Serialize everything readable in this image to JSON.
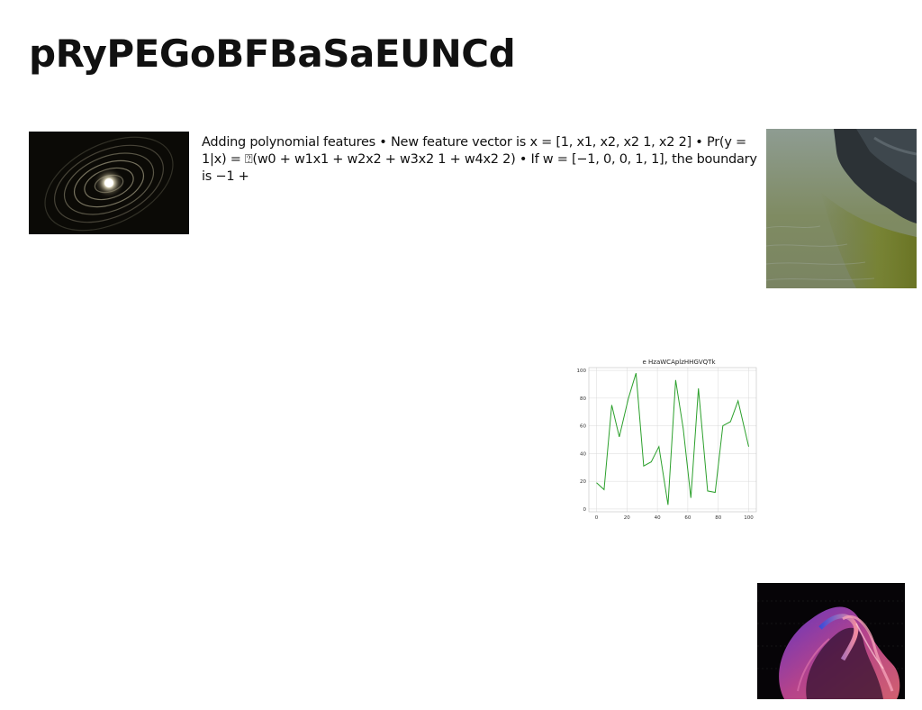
{
  "page": {
    "title": "pRyPEGoBFBaSaEUNCd",
    "body_text": "Adding polynomial features • New feature vector is x = [1, x1, x2, x2 1, x2 2] • Pr(y = 1|x) = ⍰(w0 + w1x1 + w2x2 + w3x2 1 + w4x2 2) • If w = [−1, 0, 0, 1, 1], the boundary is −1 +"
  },
  "images": {
    "spiral": "spiral-light-photo",
    "coast": "coastline-photo",
    "abstract": "abstract-swirl-art"
  },
  "colors": {
    "line": "#2ca02c",
    "grid": "#d9d9d9",
    "text": "#111111"
  },
  "chart_data": {
    "type": "line",
    "title": "e HzaWCAplzHHGVQTk",
    "xlabel": "",
    "ylabel": "",
    "xlim": [
      -5,
      105
    ],
    "ylim": [
      -2,
      102
    ],
    "xticks": [
      0,
      20,
      40,
      60,
      80,
      100
    ],
    "yticks": [
      0,
      20,
      40,
      60,
      80,
      100
    ],
    "grid": true,
    "series": [
      {
        "x": [
          0,
          5,
          10,
          15,
          21,
          26,
          31,
          36,
          41,
          47,
          52,
          57,
          62,
          67,
          73,
          78,
          83,
          88,
          93,
          100
        ],
        "values": [
          19,
          14,
          75,
          52,
          80,
          98,
          31,
          34,
          45,
          3,
          93,
          58,
          8,
          87,
          13,
          12,
          60,
          63,
          78,
          45
        ]
      }
    ]
  }
}
